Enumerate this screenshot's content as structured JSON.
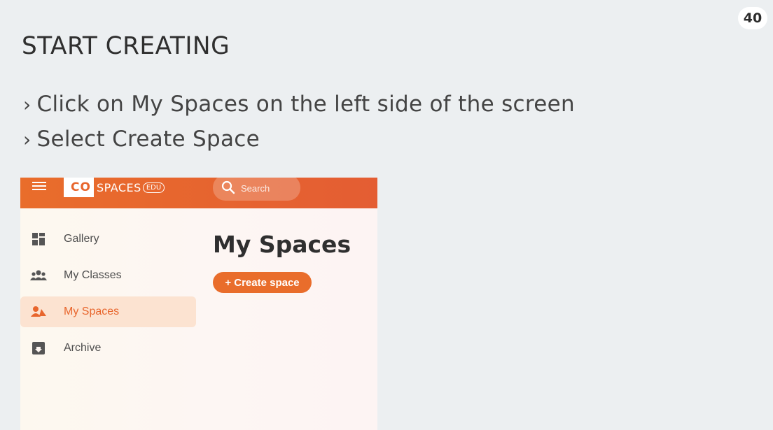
{
  "page_number": "40",
  "title": "START CREATING",
  "bullets": [
    "Click on My Spaces on the left side of the screen",
    "Select Create Space"
  ],
  "app": {
    "logo": {
      "co": "CO",
      "spaces": "SPACES",
      "edu": "EDU"
    },
    "search": {
      "placeholder": "Search"
    },
    "sidebar": {
      "items": [
        {
          "label": "Gallery",
          "icon": "grid-icon",
          "active": false
        },
        {
          "label": "My Classes",
          "icon": "group-icon",
          "active": false
        },
        {
          "label": "My Spaces",
          "icon": "user-shapes-icon",
          "active": true
        },
        {
          "label": "Archive",
          "icon": "archive-icon",
          "active": false
        }
      ]
    },
    "main": {
      "title": "My Spaces",
      "create_button": "+ Create space"
    },
    "colors": {
      "accent": "#e96d2b",
      "active_bg": "#fce3d1"
    }
  }
}
